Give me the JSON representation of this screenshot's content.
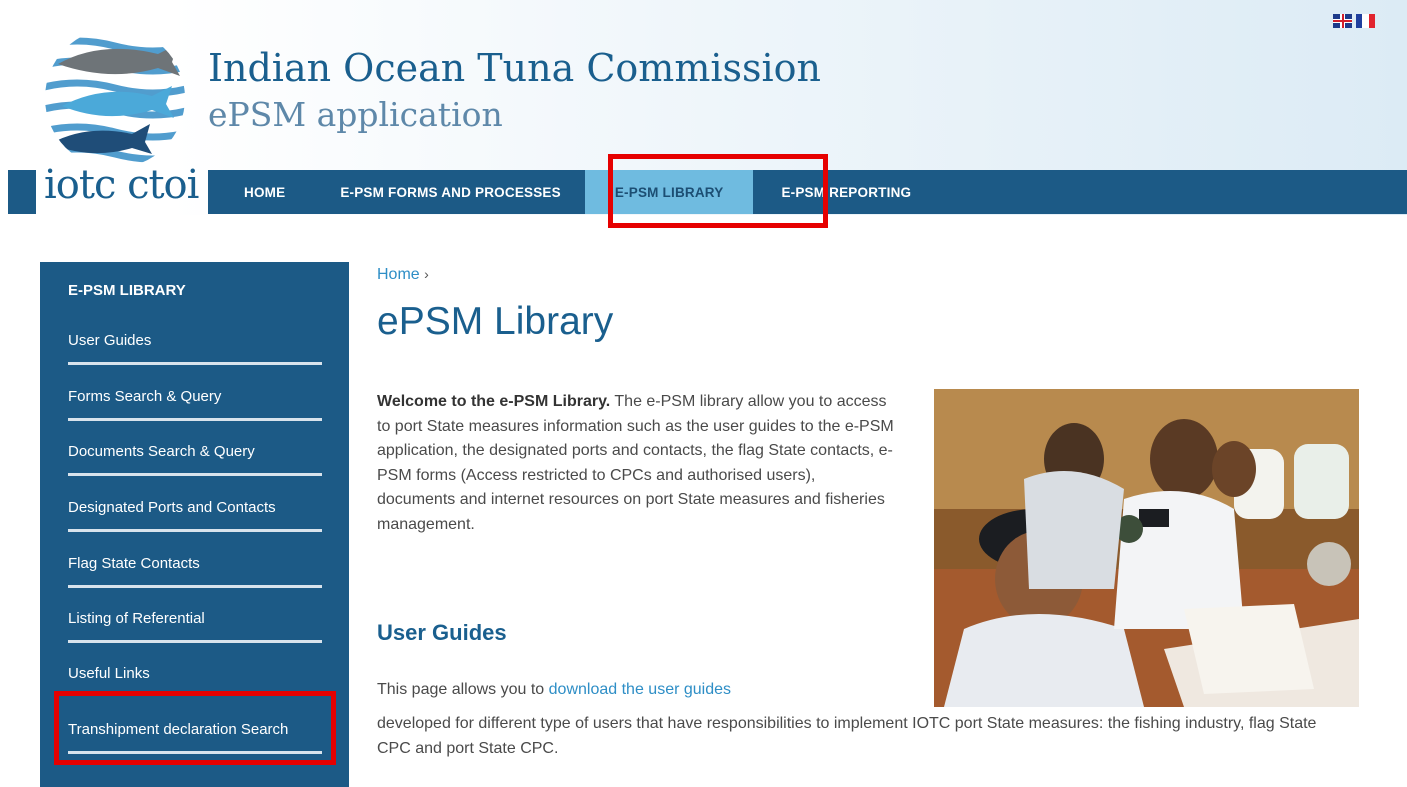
{
  "header": {
    "org_name": "Indian Ocean Tuna Commission",
    "app_name": "ePSM application",
    "logo_text": "iotc ctoi"
  },
  "language": {
    "options": [
      "English",
      "Français"
    ]
  },
  "nav": {
    "items": [
      {
        "label": "HOME"
      },
      {
        "label": "E-PSM FORMS AND PROCESSES"
      },
      {
        "label": "E-PSM LIBRARY",
        "active": true
      },
      {
        "label": "E-PSM REPORTING"
      }
    ]
  },
  "sidebar": {
    "title": "E-PSM LIBRARY",
    "items": [
      {
        "label": "User Guides"
      },
      {
        "label": "Forms Search & Query"
      },
      {
        "label": "Documents Search & Query"
      },
      {
        "label": "Designated Ports and Contacts"
      },
      {
        "label": "Flag State Contacts"
      },
      {
        "label": "Listing of Referential"
      },
      {
        "label": "Useful Links"
      },
      {
        "label": "Transhipment declaration Search"
      }
    ]
  },
  "main": {
    "breadcrumb_home": "Home",
    "breadcrumb_sep": "›",
    "title": "ePSM Library",
    "intro_bold": "Welcome to the e-PSM Library.",
    "intro_text": " The e-PSM library allow you to access to port State measures information such as the user guides to the e-PSM application, the designated ports and contacts, the flag State contacts, e-PSM forms (Access restricted to CPCs and authorised users), documents and internet resources on port State measures and fisheries management.",
    "section_title": "User Guides",
    "guides_prefix": "This page allows you to ",
    "guides_link": "download the user guides",
    "guides_text": "developed for different type of users that have responsibilities to implement IOTC port State measures: the fishing industry, flag State CPC and port State CPC."
  },
  "colors": {
    "nav_bg": "#1c5a86",
    "nav_active": "#6fbbe0",
    "link": "#2e8ec6",
    "highlight": "#e60000"
  }
}
